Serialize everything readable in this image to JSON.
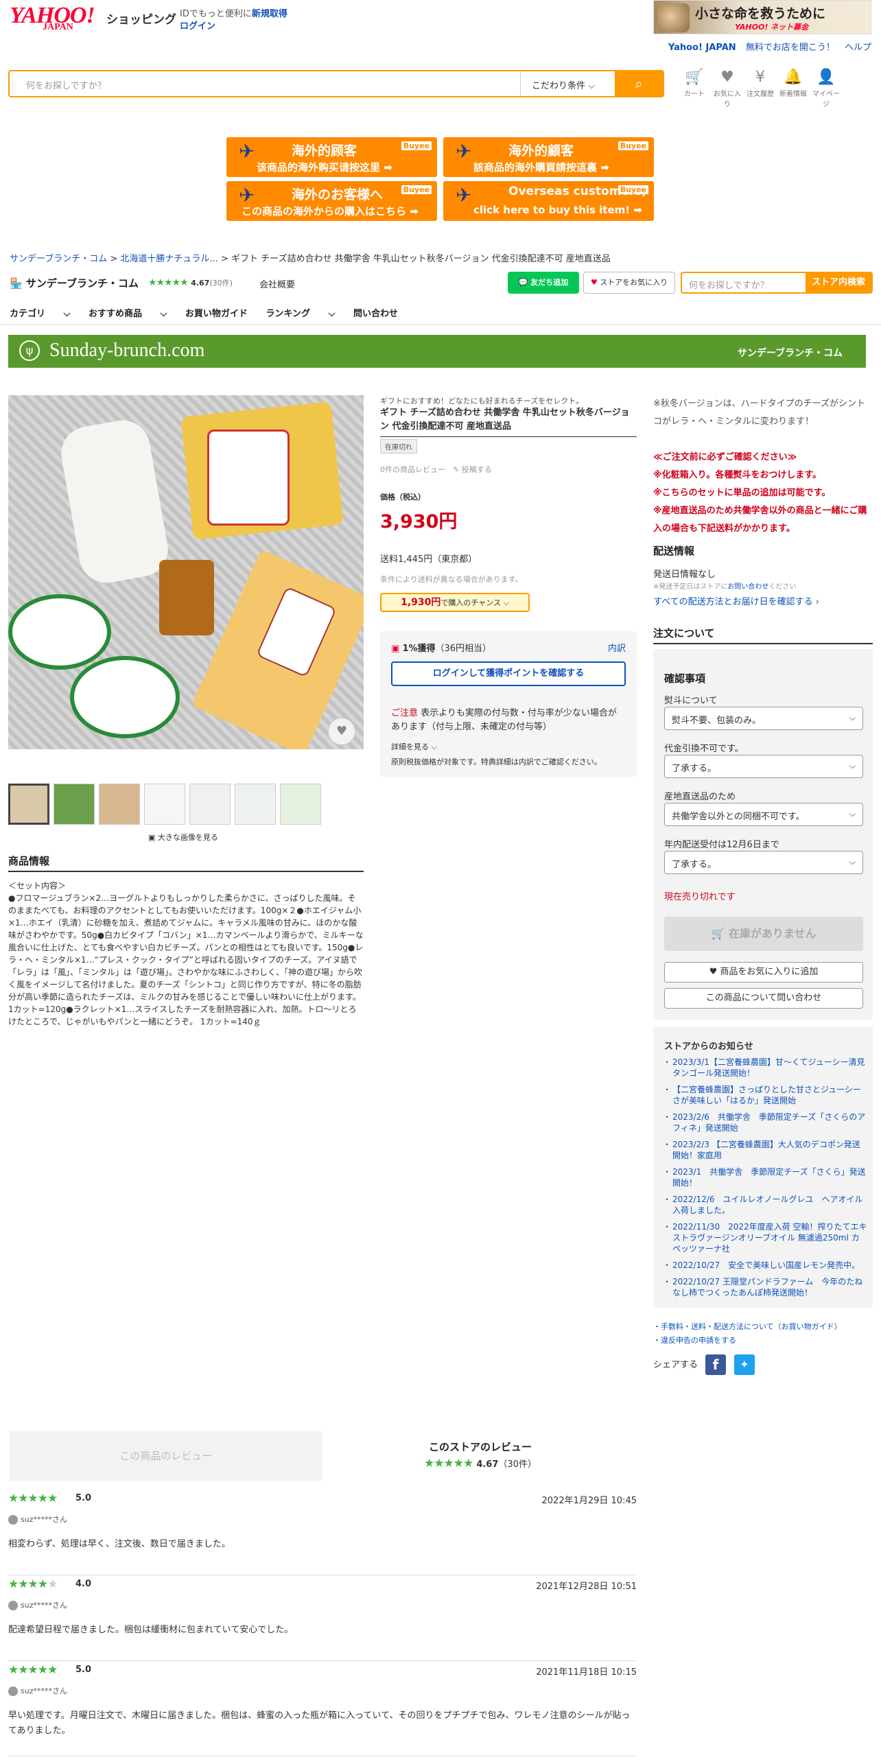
{
  "header": {
    "logo_yahoo": "YAHOO!",
    "logo_japan": "JAPAN",
    "logo_shopping": "ショッピング",
    "note_line1": "IDでもっと便利に",
    "register": "新規取得",
    "login": "ログイン",
    "banner_text": "小さな命を救うために",
    "banner_brand": "YAHOO! ネット募金",
    "link_yahoo": "Yahoo! JAPAN",
    "link_open": "無料でお店を開こう！",
    "link_help": "ヘルプ"
  },
  "search": {
    "placeholder": "何をお探しですか？",
    "condition": "こだわり条件"
  },
  "header_icons": [
    {
      "label": "カート",
      "icon": "cart-icon"
    },
    {
      "label": "お気に入り",
      "icon": "heart-icon"
    },
    {
      "label": "注文履歴",
      "icon": "yen-icon"
    },
    {
      "label": "新着情報",
      "icon": "bell-icon"
    },
    {
      "label": "マイページ",
      "icon": "user-icon"
    }
  ],
  "buyee": [
    {
      "line1": "海外的顾客",
      "line2": "该商品的海外购买请按这里 ➡"
    },
    {
      "line1": "海外的顧客",
      "line2": "該商品的海外購買請按這裏 ➡"
    },
    {
      "line1": "海外のお客様へ",
      "line2": "この商品の海外からの購入はこちら ➡"
    },
    {
      "line1": "Overseas customers,",
      "line2": "click here to buy this item! ➡"
    }
  ],
  "buyee_logo": "Buyee",
  "breadcrumb": {
    "items": [
      "サンデーブランチ・コム",
      "北海道十勝ナチュラル...",
      "ギフト チーズ詰め合わせ 共働学舎 牛乳山セット秋冬バージョン 代金引換配達不可 産地直送品"
    ]
  },
  "store": {
    "name": "サンデーブランチ・コム",
    "rating": "4.67",
    "count": "(30件)",
    "overview": "会社概要",
    "line_btn": "友だち追加",
    "fav_btn": "ストアをお気に入り",
    "search_placeholder": "何をお探しですか？",
    "search_btn": "ストア内検索",
    "banner_title": "Sunday-brunch.com",
    "banner_right": "サンデーブランチ・コム"
  },
  "store_nav": [
    "カテゴリ",
    "おすすめ商品",
    "お買い物ガイド",
    "ランキング",
    "問い合わせ"
  ],
  "product": {
    "catch": "ギフトにおすすめ！どなたにも好まれるチーズをセレクト。",
    "title": "ギフト チーズ詰め合わせ 共働学舎 牛乳山セット秋冬バージョン 代金引換配達不可 産地直送品",
    "stock": "在庫切れ",
    "review_count": "0件の商品レビュー",
    "post_review": "投稿する",
    "price_label": "価格（税込）",
    "price": "3,930円",
    "shipping": "送料1,445円（東京都）",
    "shipping_note": "条件により送料が異なる場合があります。",
    "chance_price": "1,930円",
    "chance_text": "で購入のチャンス",
    "points": "1%獲得",
    "points_detail": "（36円相当）",
    "breakdown": "内訳",
    "login_points": "ログインして獲得ポイントを確認する",
    "caution_head": "ご注意",
    "caution": "表示よりも実際の付与数・付与率が少ない場合があります（付与上限、未確定の付与等）",
    "detail_link": "詳細を見る",
    "original_price_note": "原則税抜価格が対象です。特典詳細は内訳でご確認ください。",
    "enlarge": "大きな画像を見る",
    "info_title": "商品情報",
    "description": "＜セット内容＞\n●フロマージュブラン×2…ヨーグルトよりもしっかりした柔らかさに、さっぱりした風味。そのままたべても、お料理のアクセントとしてもお使いいただけます。100g×２●ホエイジャム小×1…ホエイ（乳清）に砂糖を加え、煮詰めてジャムに。キャラメル風味の甘みに、ほのかな酸味がさわやかです。50g●白カビタイプ「コバン」×1…カマンベールより滑らかで、ミルキーな風合いに仕上げた、とても食べやすい白カビチーズ。パンとの相性はとても良いです。150g●レラ・ヘ・ミンタル×1…“プレス・クック・タイプ”と呼ばれる固いタイプのチーズ。アイヌ語で「レラ」は「風」、「ミンタル」は「遊び場」。さわやかな味にふさわしく、「神の遊び場」から吹く風をイメージして名付けました。夏のチーズ「シントコ」と同じ作り方ですが、特に冬の脂肪分が高い季節に造られたチーズは、ミルクの甘みを感じることで優しい味わいに仕上がります。1カット=120g●ラクレット×1…スライスしたチーズを耐熱容器に入れ、加熱。トロ〜リとろけたところで、じゃがいもやパンと一緒にどうぞ。 1カット=140ｇ"
  },
  "right": {
    "note": "※秋冬バージョンは、ハードタイプのチーズがシントコがレラ・ヘ・ミンタルに変わります！",
    "warnings": [
      "≪ご注文前に必ずご確認ください≫",
      "※化粧箱入り。各種熨斗をおつけします。",
      "※こちらのセットに単品の追加は可能です。",
      "※産地直送品のため共働学舎以外の商品と一緒にご購入の場合も下記送料がかかります。"
    ],
    "ship_title": "配送情報",
    "ship_date": "発送日情報なし",
    "ship_note_a": "※発送予定日はストアに",
    "ship_note_link": "お問い合わせ",
    "ship_note_b": "ください",
    "ship_link": "すべての配送方法とお届け日を確認する",
    "order_title": "注文について",
    "confirm_title": "確認事項",
    "selects": [
      {
        "label": "熨斗について",
        "value": "熨斗不要、包装のみ。"
      },
      {
        "label": "代金引換不可です。",
        "value": "了承する。"
      },
      {
        "label": "産地直送品のため",
        "value": "共働学舎以外との同梱不可です。"
      },
      {
        "label": "年内配送受付は12月6日まで",
        "value": "了承する。"
      }
    ],
    "sold_out": "現在売り切れです",
    "no_stock_btn": "在庫がありません",
    "fav_btn": "商品をお気に入りに追加",
    "inquiry_btn": "この商品について問い合わせ",
    "news_title": "ストアからのお知らせ",
    "news": [
      "2023/3/1【二宮養蜂農園】甘～くてジューシー清見タンゴール発送開始！",
      "【二宮養蜂農園】さっぱりとした甘さとジューシーさが美味しい「はるか」発送開始",
      "2023/2/6　共働学舎　季節限定チーズ「さくらのアフィネ」発送開始",
      "2023/2/3 【二宮養蜂農園】大人気のデコポン発送開始！家庭用",
      "2023/1　共働学舎　季節限定チーズ「さくら」発送開始！",
      "2022/12/6　ユイルレオノールグレユ　ヘアオイル入荷しました。",
      "2022/11/30　2022年度産入荷 空輸！搾りたてエキストラヴァージンオリーブオイル 無濾過250ml カペッツァーナ社",
      "2022/10/27　安全で美味しい国産レモン発売中。",
      "2022/10/27 王隠堂パンドラファーム　今年のたねなし柿でつくったあんぽ柿発送開始！"
    ],
    "footer_links": [
      "手数料・送料・配送方法について（お買い物ガイド）",
      "違反申告の申請をする"
    ],
    "share": "シェアする"
  },
  "reviews": {
    "tab_product": "この商品のレビュー",
    "tab_store": "このストアのレビュー",
    "store_rating": "4.67",
    "store_count": "（30件）",
    "items": [
      {
        "score": "5.0",
        "stars": 5,
        "date": "2022年1月29日 10:45",
        "user": "suz*****さん",
        "text": "相変わらず、処理は早く、注文後、数日で届きました。"
      },
      {
        "score": "4.0",
        "stars": 4,
        "date": "2021年12月28日 10:51",
        "user": "suz*****さん",
        "text": "配達希望日程で届きました。梱包は緩衝材に包まれていて安心でした。"
      },
      {
        "score": "5.0",
        "stars": 5,
        "date": "2021年11月18日 10:15",
        "user": "suz*****さん",
        "text": "早い処理です。月曜日注文で、木曜日に届きました。梱包は、蜂蜜の入った瓶が箱に入っていて、その回りをプチプチで包み、ワレモノ注意のシールが貼ってありました。"
      }
    ]
  },
  "colors": {
    "accent": "#ff9900",
    "price": "#d0021b",
    "link": "#0f52ba",
    "brand_green": "#5a9a2c",
    "line": "#06c755"
  }
}
